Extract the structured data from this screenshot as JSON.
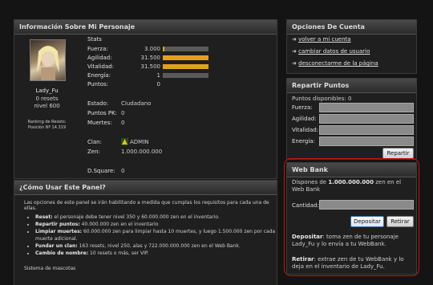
{
  "char_panel": {
    "title": "Información Sobre Mi Personaje",
    "name": "Lady_Fu",
    "resets": "0 resets",
    "level": "nivel 600",
    "ranking_label": "Ranking de Resets:",
    "position": "Posición Nº 14.319",
    "stats_title": "Stats",
    "stats": [
      {
        "label": "Fuerza:",
        "value": "3.000",
        "fill": 0.035
      },
      {
        "label": "Agilidad:",
        "value": "31.500",
        "fill": 1.0
      },
      {
        "label": "Vitalidad:",
        "value": "31.500",
        "fill": 1.0
      },
      {
        "label": "Energía:",
        "value": "1",
        "fill": 0.0
      },
      {
        "label": "Puntos:",
        "value": "0",
        "fill": 0.0
      }
    ],
    "estado_label": "Estado:",
    "estado": "Ciudadano",
    "pk_label": "Puntos PK:",
    "pk": "0",
    "muertes_label": "Muertes:",
    "muertes": "0",
    "clan_label": "Clan:",
    "clan": "ADMIN",
    "zen_label": "Zen:",
    "zen": "1.000.000.000",
    "dsquare_label": "D.Square:",
    "dsquare": "0"
  },
  "help_panel": {
    "title": "¿Cómo Usar Este Panel?",
    "intro": "Las opciones de este panel se irán habilitando a medida que cumplas los requisitos para cada una de ellas.",
    "items": [
      {
        "bold": "Reset:",
        "text": " el personaje debe tener nivel 350 y 60.000.000 zen en el inventario."
      },
      {
        "bold": "Repartir puntos:",
        "text": " 40.000.000 zen en el inventario"
      },
      {
        "bold": "Limpiar muertes:",
        "text": " 60.000.000 zen para limpiar hasta 10 muertes, y luego 1.500.000 zen por cada muerte adicional."
      },
      {
        "bold": "Fundar un clan:",
        "text": " 163 resets, nivel 250, alas y 722.000.000.000 zen en el Web Bank."
      },
      {
        "bold": "Cambio de nombre:",
        "text": " 10 resets o más, ser VIP."
      }
    ],
    "footer": "Sistema de mascotas"
  },
  "account_panel": {
    "title": "Opciones De Cuenta",
    "links": [
      "volver a mi cuenta",
      "cambiar datos de usuario",
      "desconectarme de la página"
    ]
  },
  "points_panel": {
    "title": "Repartir Puntos",
    "available_label": "Puntos disponibles:",
    "available": "0",
    "fields": [
      "Fuerza:",
      "Agilidad:",
      "Vitalidad:",
      "Energía:"
    ],
    "button": "Repartir"
  },
  "bank_panel": {
    "title": "Web Bank",
    "text_pre": "Dispones de ",
    "amount": "1.000.000.000",
    "text_post": " zen en el Web Bank",
    "cantidad_label": "Cantidad:",
    "deposit_button": "Depositar",
    "withdraw_button": "Retirar",
    "deposit_bold": "Depositar",
    "deposit_desc": ": toma zen de tu personaje Lady_Fu y lo envía a tu WebBank.",
    "withdraw_bold": "Retirar",
    "withdraw_desc": ": extrae zen de tu WebBank y lo deja en el inventario de Lady_Fu."
  },
  "colors": {
    "highlight_border": "#cc1111",
    "bar_fill": "#e0a21c"
  }
}
